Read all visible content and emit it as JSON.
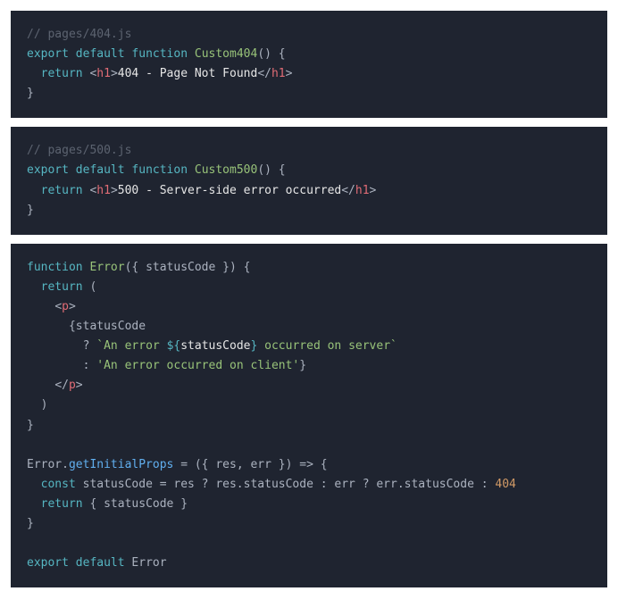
{
  "blocks": {
    "b1": {
      "comment": "// pages/404.js",
      "kw_export": "export",
      "kw_default": "default",
      "kw_function": "function",
      "fn_name": "Custom404",
      "parens_open": "()",
      "brace_open": " {",
      "kw_return": "return",
      "lt1": " <",
      "tag1": "h1",
      "gt1": ">",
      "text1": "404 - Page Not Found",
      "lt2": "</",
      "tag2": "h1",
      "gt2": ">",
      "brace_close": "}"
    },
    "b2": {
      "comment": "// pages/500.js",
      "kw_export": "export",
      "kw_default": "default",
      "kw_function": "function",
      "fn_name": "Custom500",
      "parens_open": "()",
      "brace_open": " {",
      "kw_return": "return",
      "lt1": " <",
      "tag1": "h1",
      "gt1": ">",
      "text1": "500 - Server-side error occurred",
      "lt2": "</",
      "tag2": "h1",
      "gt2": ">",
      "brace_close": "}"
    },
    "b3": {
      "l1_kw_function": "function",
      "l1_fn": " Error",
      "l1_rest": "({ statusCode }) {",
      "l2_return": "return",
      "l2_rest": " (",
      "l3_lt": "<",
      "l3_tag": "p",
      "l3_gt": ">",
      "l4": "{statusCode",
      "l5_q": "? ",
      "l5_bt1": "`",
      "l5_s1": "An error ",
      "l5_dollar": "${",
      "l5_var": "statusCode",
      "l5_cbrace": "}",
      "l5_s2": " occurred on server",
      "l5_bt2": "`",
      "l6_colon": ": ",
      "l6_str": "'An error occurred on client'",
      "l6_cbrace": "}",
      "l7_lt": "</",
      "l7_tag": "p",
      "l7_gt": ">",
      "l8": ")",
      "l9": "}",
      "l10_a": "Error.",
      "l10_prop": "getInitialProps",
      "l10_b": " = ({ res, err }) => {",
      "l11_const": "const",
      "l11_a": " statusCode = res ? res.statusCode : err ? err.statusCode : ",
      "l11_num": "404",
      "l12_return": "return",
      "l12_rest": " { statusCode }",
      "l13": "}",
      "l14_export": "export",
      "l14_default": "default",
      "l14_rest": " Error"
    }
  }
}
